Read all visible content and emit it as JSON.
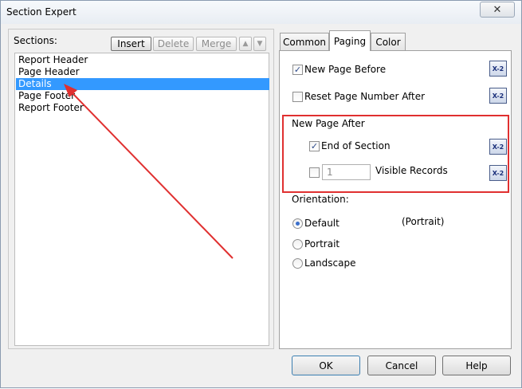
{
  "window": {
    "title": "Section Expert",
    "close_glyph": "✕"
  },
  "sections": {
    "label": "Sections:",
    "toolbar": {
      "insert": "Insert",
      "delete": "Delete",
      "merge": "Merge",
      "up_icon": "up-arrow-icon",
      "down_icon": "down-arrow-icon"
    },
    "items": [
      {
        "label": "Report Header",
        "selected": false
      },
      {
        "label": "Page Header",
        "selected": false
      },
      {
        "label": "Details",
        "selected": true
      },
      {
        "label": "Page Footer",
        "selected": false
      },
      {
        "label": "Report Footer",
        "selected": false
      }
    ]
  },
  "tabs": [
    {
      "label": "Common",
      "active": false
    },
    {
      "label": "Paging",
      "active": true
    },
    {
      "label": "Color",
      "active": false
    }
  ],
  "paging": {
    "new_page_before": {
      "label": "New Page Before",
      "checked": true
    },
    "reset_page_number_after": {
      "label": "Reset Page Number After",
      "checked": false
    },
    "new_page_after": {
      "label": "New Page After",
      "end_of_section": {
        "label": "End of Section",
        "checked": true
      },
      "visible_records": {
        "label": "Visible Records",
        "checked": false,
        "value": "1"
      }
    },
    "formula_button_text": "X-2",
    "orientation": {
      "label": "Orientation:",
      "options": [
        {
          "label": "Default",
          "checked": true
        },
        {
          "label": "Portrait",
          "checked": false
        },
        {
          "label": "Landscape",
          "checked": false
        }
      ],
      "default_hint": "(Portrait)"
    }
  },
  "buttons": {
    "ok": "OK",
    "cancel": "Cancel",
    "help": "Help"
  },
  "annotation_color": "#e03030",
  "selection_color": "#3399ff"
}
